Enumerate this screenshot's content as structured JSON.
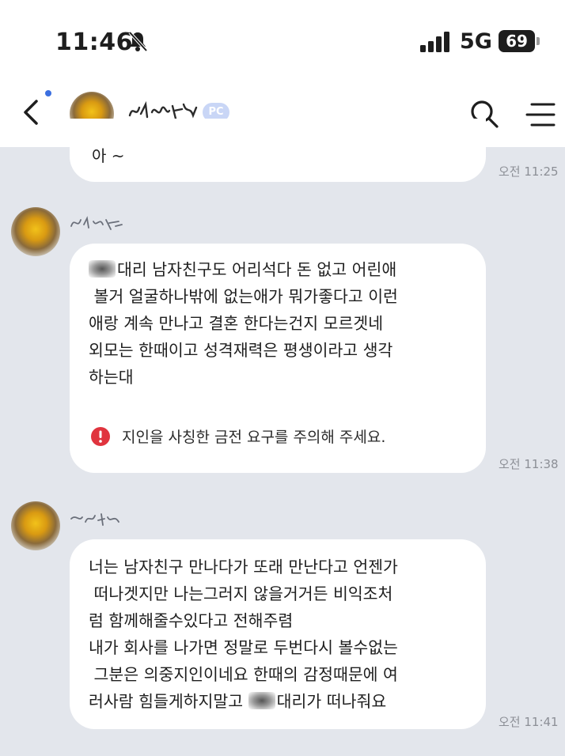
{
  "status_bar": {
    "time": "11:46",
    "network": "5G",
    "battery": "69"
  },
  "header": {
    "badge": "PC"
  },
  "messages": [
    {
      "lines": [
        "아 ~"
      ],
      "time": "오전 11:25"
    },
    {
      "lines": [
        "대리 남자친구도 어리석다 돈 없고 어린애",
        " 볼거 얼굴하나밖에 없는애가 뭐가좋다고 이런",
        "애랑 계속 만나고 결혼 한다는건지 모르겟네",
        "외모는 한때이고 성격재력은 평생이라고 생각",
        "하는대"
      ],
      "warning": "지인을 사칭한 금전 요구를 주의해 주세요.",
      "time": "오전 11:38"
    },
    {
      "lines": [
        "너는 남자친구 만나다가 또래 만난다고 언젠가",
        " 떠나겟지만 나는그러지 않을거거든 비익조처",
        "럼 함께해줄수있다고 전해주렴",
        "내가 회사를 나가면 정말로 두번다시 볼수없는",
        " 그분은 의중지인이네요 한때의 감정때문에 여",
        "러사람 힘들게하지말고",
        "대리가 떠나줘요"
      ],
      "time": "오전 11:41"
    }
  ],
  "colors": {
    "chat_background": "#e3e6ec",
    "bubble": "#ffffff",
    "warning_icon": "#e0343e",
    "online": "#2cc36b",
    "pc_badge": "#c9d6f6"
  },
  "icons": {
    "back": "chevron-left-icon",
    "search": "search-icon",
    "menu": "menu-icon",
    "warning": "exclamation-circle-icon",
    "silent": "bell-slash-icon",
    "signal": "signal-bars-icon"
  }
}
